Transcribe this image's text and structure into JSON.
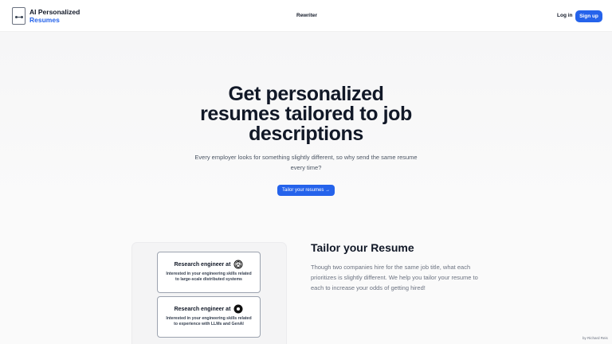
{
  "navbar": {
    "logo_line1": "AI Personalized",
    "logo_line2": "Resumes",
    "rewriter_label": "Rewriter",
    "login_label": "Log in",
    "signup_label": "Sign up"
  },
  "hero": {
    "title": "Get personalized resumes tailored to job descriptions",
    "subtitle": "Every employer looks for something slightly different, so why send the same resume every time?",
    "cta_label": "Tailor your resumes →"
  },
  "preview": {
    "cards": [
      {
        "title": "Research engineer at",
        "logo": "openai-logo-icon",
        "description": "Interested in your engineering skills related to large-scale distributed systems"
      },
      {
        "title": "Research engineer at",
        "logo": "company-logo-icon",
        "description": "Interested in your engineering skills related to experience with LLMs and GenAI"
      }
    ]
  },
  "feature": {
    "title": "Tailor your Resume",
    "text": "Though two companies hire for the same job title, what each prioritizes is slightly different. We help you tailor your resume to each to increase your odds of getting hired!"
  },
  "footer": {
    "byline": "by Richard Reis"
  },
  "colors": {
    "accent": "#2563eb",
    "text": "#111827",
    "muted": "#6b7280"
  }
}
